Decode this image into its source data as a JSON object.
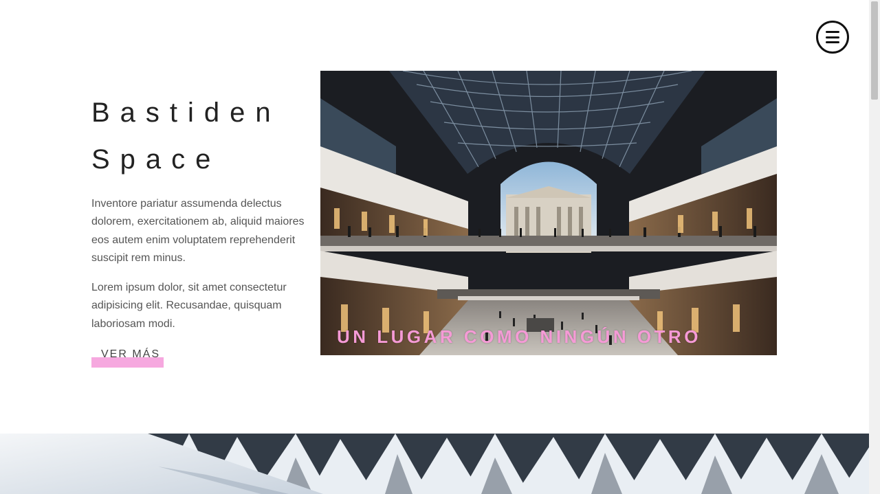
{
  "brand": {
    "title_line1": "Bastiden",
    "title_line2": "Space"
  },
  "intro": {
    "paragraph1": "Inventore pariatur assumenda delectus dolorem, exercitationem ab, aliquid maiores eos autem enim voluptatem reprehenderit suscipit rem minus.",
    "paragraph2": "Lorem ipsum dolor, sit amet consectetur adipisicing elit. Recusandae, quisquam laboriosam modi."
  },
  "cta": {
    "label": "VER MÁS",
    "highlight_color": "#f6a8df"
  },
  "hero": {
    "caption": "UN LUGAR COMO NINGÚN OTRO",
    "caption_color": "#f59ad6",
    "image_subject": "shopping mall atrium with glass roof"
  },
  "snow_image": {
    "image_subject": "snow-covered pine forest"
  },
  "menu": {
    "icon": "hamburger-menu-icon"
  },
  "colors": {
    "text_dark": "#222222",
    "text_body": "#555555",
    "accent_pink": "#f6a8df"
  }
}
